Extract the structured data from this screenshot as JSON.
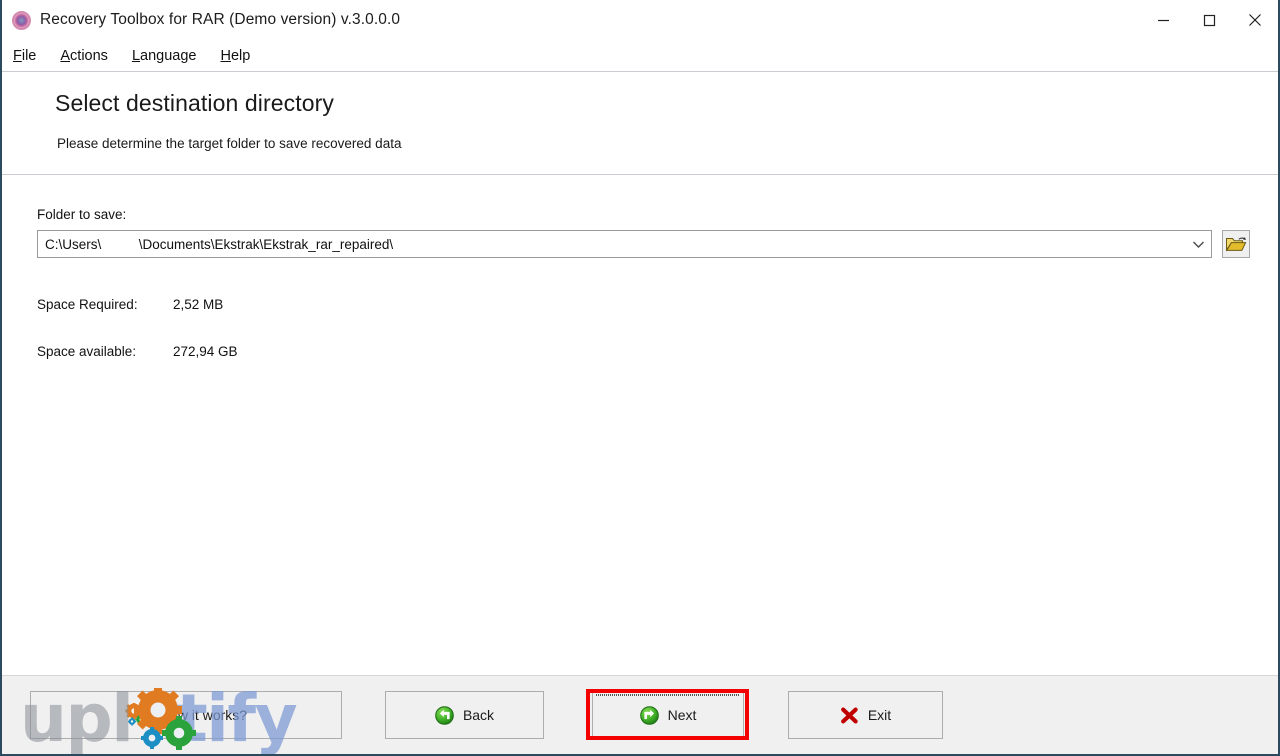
{
  "window": {
    "title": "Recovery Toolbox for RAR (Demo version) v.3.0.0.0",
    "logo_icon": "app-logo-icon",
    "controls": [
      {
        "name": "minimize",
        "icon": "minimize-icon"
      },
      {
        "name": "maximize",
        "icon": "maximize-icon"
      },
      {
        "name": "close",
        "icon": "close-icon"
      }
    ]
  },
  "menubar": {
    "items": [
      {
        "accesskey": "F",
        "rest": "ile"
      },
      {
        "accesskey": "A",
        "rest": "ctions"
      },
      {
        "accesskey": "L",
        "rest": "anguage"
      },
      {
        "accesskey": "H",
        "rest": "elp"
      }
    ]
  },
  "header": {
    "title": "Select destination directory",
    "subtitle": "Please determine the target folder to save recovered data"
  },
  "content": {
    "folder_label": "Folder to save:",
    "folder_path": "C:\\Users\\          \\Documents\\Ekstrak\\Ekstrak_rar_repaired\\",
    "dropdown_icon": "chevron-down-icon",
    "browse_icon": "open-folder-icon",
    "space_required_label": "Space Required:",
    "space_required_value": "2,52 MB",
    "space_available_label": "Space available:",
    "space_available_value": "272,94 GB"
  },
  "footer": {
    "how_it_works_label": "How it works?",
    "how_it_works_icon": "gears-icon",
    "back_label": "Back",
    "back_icon": "arrow-left-circle-icon",
    "next_label": "Next",
    "next_icon": "arrow-right-circle-icon",
    "exit_label": "Exit",
    "exit_icon": "red-x-icon"
  },
  "watermark": {
    "part1": "upl",
    "part2": "tify"
  },
  "colors": {
    "window_border": "#2c4a5e",
    "toolbar_bg": "#f0f0f0",
    "highlight_red": "#f40000",
    "green_icon": "#3fa62a",
    "exit_red": "#c00000",
    "folder_yellow": "#e8c433",
    "watermark_blue": "#7b9ad4"
  }
}
